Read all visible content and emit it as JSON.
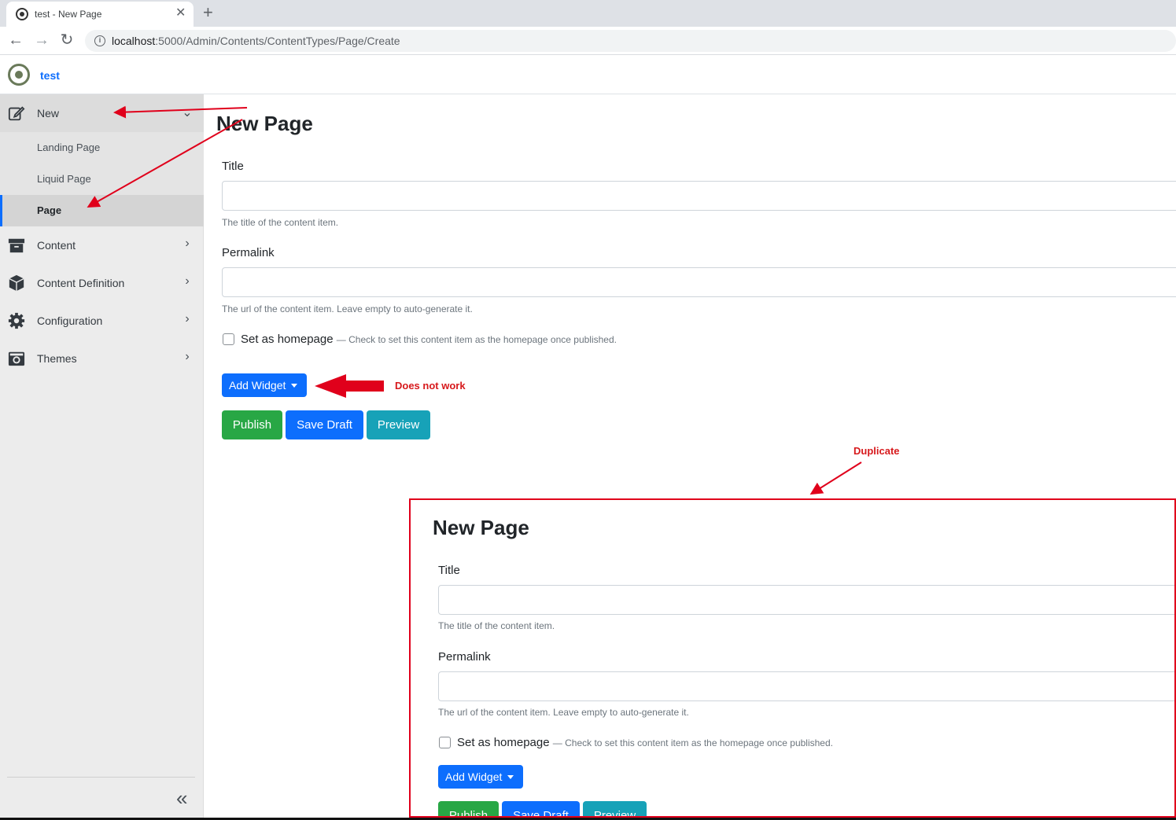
{
  "browser": {
    "tab_title": "test - New Page",
    "tab_close": "✕",
    "new_tab": "+",
    "back": "←",
    "forward": "→",
    "reload": "↻",
    "url_host": "localhost",
    "url_path": ":5000/Admin/Contents/ContentTypes/Page/Create"
  },
  "header": {
    "brand_name": "test"
  },
  "sidebar": {
    "new_label": "New",
    "sub_items": [
      "Landing Page",
      "Liquid Page",
      "Page"
    ],
    "items": [
      {
        "label": "Content",
        "icon": "archive-icon"
      },
      {
        "label": "Content Definition",
        "icon": "cube-icon"
      },
      {
        "label": "Configuration",
        "icon": "gear-icon"
      },
      {
        "label": "Themes",
        "icon": "camera-icon"
      }
    ],
    "collapse": "«"
  },
  "form": {
    "page_title": "New Page",
    "title_label": "Title",
    "title_hint": "The title of the content item.",
    "permalink_label": "Permalink",
    "permalink_hint": "The url of the content item. Leave empty to auto-generate it.",
    "homepage_label": "Set as homepage",
    "homepage_hint": "— Check to set this content item as the homepage once published.",
    "add_widget": "Add Widget",
    "publish": "Publish",
    "save_draft": "Save Draft",
    "preview": "Preview"
  },
  "annotations": {
    "does_not_work": "Does not work",
    "duplicate": "Duplicate",
    "color": "#e0001b"
  }
}
